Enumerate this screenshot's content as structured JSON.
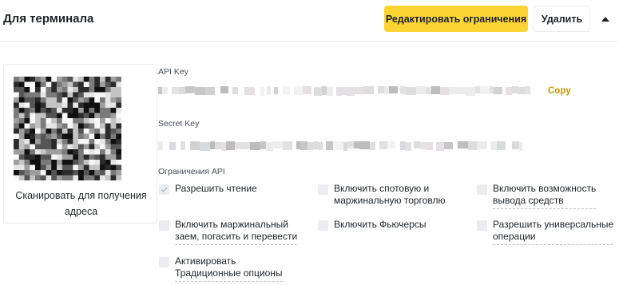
{
  "header": {
    "title": "Для терминала",
    "edit_button": "Редактировать ограничения",
    "delete_button": "Удалить",
    "collapse_icon": "caret-up-icon"
  },
  "qr": {
    "caption": "Сканировать для получения\nадреса"
  },
  "api_key": {
    "label": "API Key",
    "copy_label": "Copy"
  },
  "secret_key": {
    "label": "Secret Key"
  },
  "restrictions": {
    "label": "Ограничения API",
    "items": [
      {
        "label": "Разрешить чтение",
        "checked": true
      },
      {
        "label": "Включить спотовую и\nмаржинальную торговлю",
        "checked": false
      },
      {
        "label": "Включить возможность\nвывода средств",
        "checked": false
      },
      {
        "label": "Включить маржинальный\nзаем, погасить и перевести",
        "checked": false
      },
      {
        "label": "Включить Фьючерсы",
        "checked": false
      },
      {
        "label": "Разрешить универсальные\nоперации",
        "checked": false
      },
      {
        "label": "Активировать\nТрадиционные опционы",
        "checked": false
      }
    ]
  },
  "colors": {
    "accent": "#fcd535",
    "link": "#c99400",
    "checkbox_bg": "#eaecef",
    "check_mark": "#b7bdc6"
  }
}
